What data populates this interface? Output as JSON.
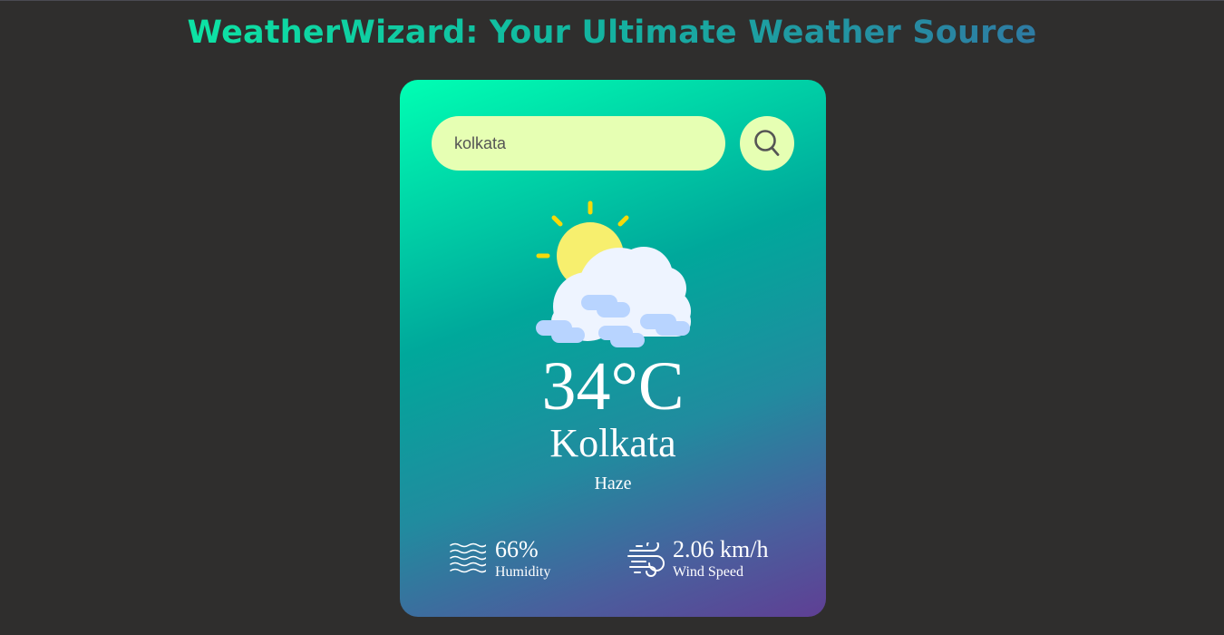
{
  "header": {
    "title": "WeatherWizard: Your Ultimate Weather Source"
  },
  "search": {
    "value": "kolkata",
    "button_icon": "search-icon"
  },
  "weather": {
    "icon": "partly-cloudy-icon",
    "temperature": "34°C",
    "city": "Kolkata",
    "condition": "Haze"
  },
  "details": {
    "humidity": {
      "value": "66%",
      "label": "Humidity",
      "icon": "humidity-icon"
    },
    "wind": {
      "value": "2.06 km/h",
      "label": "Wind Speed",
      "icon": "wind-icon"
    }
  },
  "colors": {
    "background": "#2f2e2d",
    "input_bg": "#e6ffb3",
    "card_gradient_start": "#00ffb3",
    "card_gradient_end": "#5f3f94",
    "sun": "#f7ef6e",
    "cloud": "#eef4ff"
  }
}
